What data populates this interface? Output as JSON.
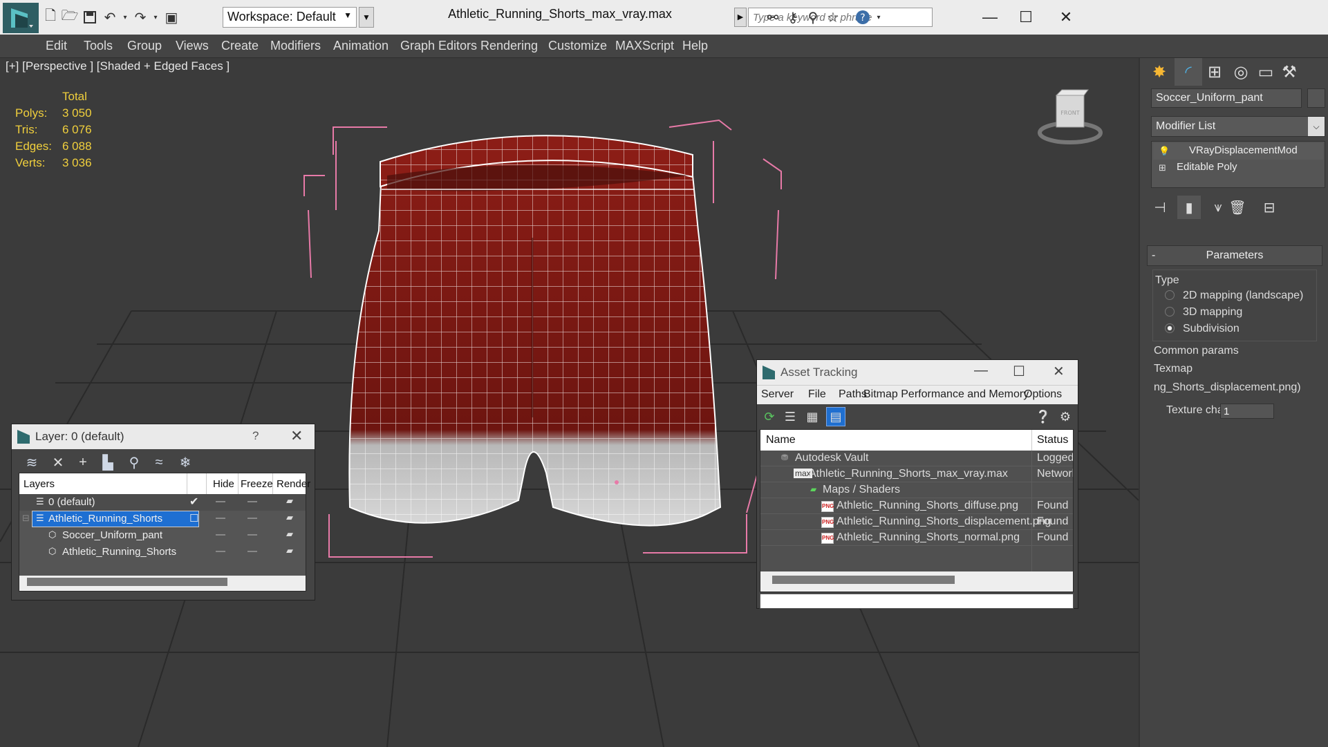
{
  "title_bar": {
    "workspace_label": "Workspace: Default",
    "document_title": "Athletic_Running_Shorts_max_vray.max",
    "search_placeholder": "Type a keyword or phrase"
  },
  "menu": {
    "items": [
      "Edit",
      "Tools",
      "Group",
      "Views",
      "Create",
      "Modifiers",
      "Animation",
      "Graph Editors",
      "Rendering",
      "Customize",
      "MAXScript",
      "Help"
    ]
  },
  "viewport": {
    "label": "[+] [Perspective ] [Shaded + Edged Faces ]",
    "stats": {
      "header": "Total",
      "rows": [
        {
          "label": "Polys:",
          "value": "3 050"
        },
        {
          "label": "Tris:",
          "value": "6 076"
        },
        {
          "label": "Edges:",
          "value": "6 088"
        },
        {
          "label": "Verts:",
          "value": "3 036"
        }
      ]
    },
    "viewcube_label": "FRONT"
  },
  "command_panel": {
    "object_name": "Soccer_Uniform_pant",
    "modifier_list_label": "Modifier List",
    "stack": [
      "VRayDisplacementMod",
      "Editable Poly"
    ],
    "parameters_title": "Parameters",
    "type_label": "Type",
    "type_options": [
      {
        "label": "2D mapping (landscape)",
        "selected": false
      },
      {
        "label": "3D mapping",
        "selected": false
      },
      {
        "label": "Subdivision",
        "selected": true
      }
    ],
    "common_params_label": "Common params",
    "texmap_label": "Texmap",
    "texmap_value": "ng_Shorts_displacement.png)",
    "texture_chan_label": "Texture chan",
    "texture_chan_value": "1"
  },
  "layer_dialog": {
    "title": "Layer: 0 (default)",
    "help": "?",
    "columns": {
      "layers": "Layers",
      "hide": "Hide",
      "freeze": "Freeze",
      "render": "Render"
    },
    "rows": [
      {
        "name": "0 (default)"
      },
      {
        "name": "Athletic_Running_Shorts"
      },
      {
        "name": "Soccer_Uniform_pant"
      },
      {
        "name": "Athletic_Running_Shorts"
      }
    ]
  },
  "asset_dialog": {
    "title": "Asset Tracking",
    "menu": [
      "Server",
      "File",
      "Paths",
      "Bitmap Performance and Memory",
      "Options"
    ],
    "columns": {
      "name": "Name",
      "status": "Status"
    },
    "rows": [
      {
        "name": "Autodesk Vault",
        "status": "Logged C"
      },
      {
        "name": "Athletic_Running_Shorts_max_vray.max",
        "status": "Network"
      },
      {
        "name": "Maps / Shaders",
        "status": ""
      },
      {
        "name": "Athletic_Running_Shorts_diffuse.png",
        "status": "Found"
      },
      {
        "name": "Athletic_Running_Shorts_displacement.png",
        "status": "Found"
      },
      {
        "name": "Athletic_Running_Shorts_normal.png",
        "status": "Found"
      }
    ],
    "png_badge": "PNG"
  },
  "colors": {
    "shorts_red": "#7a1a14",
    "bbox_pink": "#e87aa8",
    "stats_yellow": "#f0cf3c",
    "selection_blue": "#1e6fd2"
  }
}
